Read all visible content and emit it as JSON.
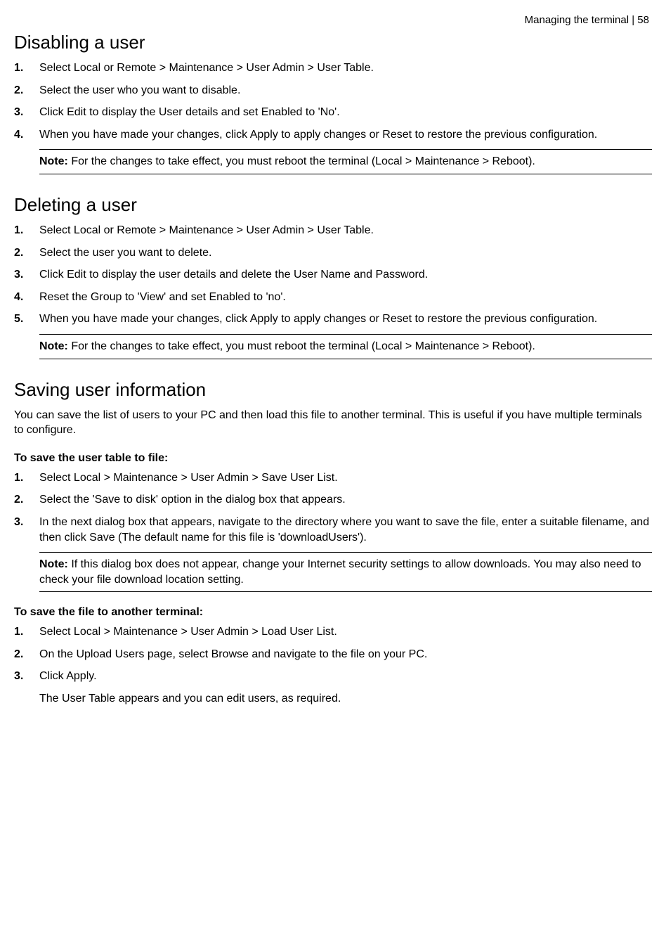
{
  "header": {
    "breadcrumb": "Managing the terminal  |  58"
  },
  "section1": {
    "title": "Disabling a user",
    "steps": [
      "Select Local or Remote > Maintenance > User Admin > User Table.",
      "Select the user who you want to disable.",
      "Click Edit to display the User details and set Enabled to 'No'.",
      "When you have made your changes, click Apply to apply changes or Reset to restore the previous configuration."
    ],
    "note_label": "Note:",
    "note": " For the changes to take effect, you must reboot the terminal (Local > Maintenance > Reboot)."
  },
  "section2": {
    "title": "Deleting a user",
    "steps": [
      "Select Local or Remote > Maintenance > User Admin > User Table.",
      "Select the user you want to delete.",
      "Click Edit to display the user details and delete the User Name and Password.",
      "Reset the Group to 'View' and set Enabled to 'no'.",
      "When you have made your changes, click Apply to apply changes or Reset to restore the previous configuration."
    ],
    "note_label": "Note:",
    "note": " For the changes to take effect, you must reboot the terminal (Local > Maintenance > Reboot)."
  },
  "section3": {
    "title": "Saving user information",
    "intro": "You can save the list of users to your PC and then load this file to another terminal. This is useful if you have multiple terminals to configure.",
    "sub1_title": "To save the user table to file:",
    "sub1_steps": [
      "Select Local > Maintenance > User Admin > Save User List.",
      "Select the 'Save to disk' option in the dialog box that appears.",
      "In the next dialog box that appears, navigate to the directory where you want to save the file, enter a suitable filename, and then click Save (The default name for this file is 'downloadUsers')."
    ],
    "sub1_note_label": "Note:",
    "sub1_note": " If this dialog box does not appear, change your Internet security settings to allow downloads. You may also need to check your file download location setting.",
    "sub2_title": "To save the file to another terminal:",
    "sub2_steps": [
      "Select Local > Maintenance > User Admin > Load User List.",
      "On the Upload Users page, select Browse and navigate to the file on your PC.",
      "Click Apply."
    ],
    "sub2_trailing": "The User Table appears and you can edit users, as required."
  }
}
